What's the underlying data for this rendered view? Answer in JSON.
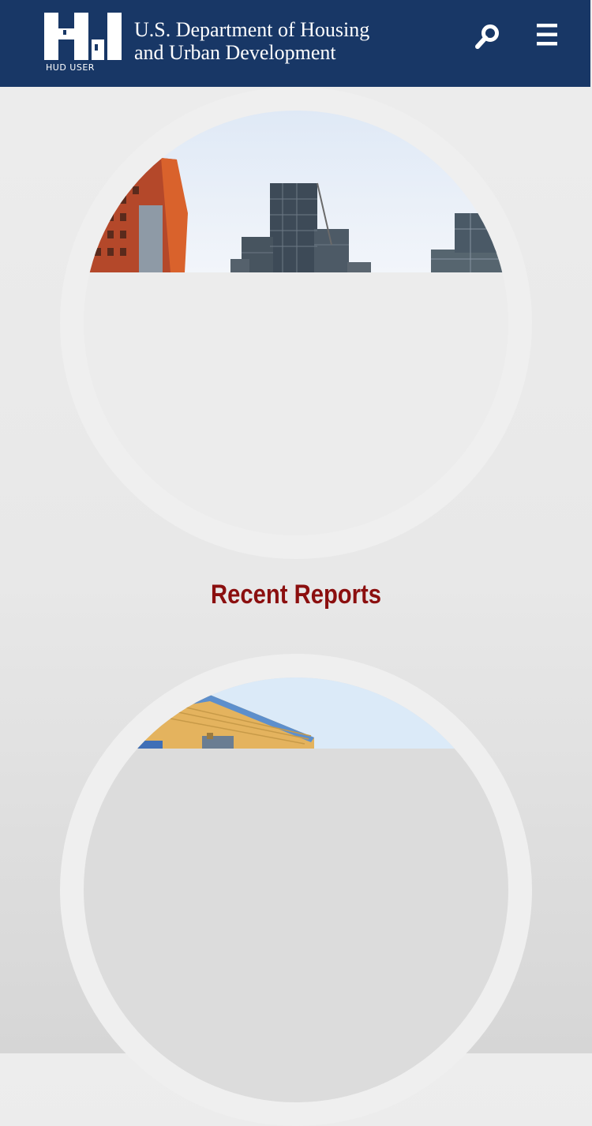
{
  "header": {
    "logo_caption": "HUD USER",
    "org_name_line1": "U.S. Department of Housing",
    "org_name_line2": "and Urban Development",
    "search_icon": "search-icon",
    "menu_icon": "hamburger-menu-icon"
  },
  "colors": {
    "header_bg": "#183766",
    "title_red": "#8b0f0f",
    "card_ring": "#efefef"
  },
  "main": {
    "section_title": "Recent Reports"
  }
}
